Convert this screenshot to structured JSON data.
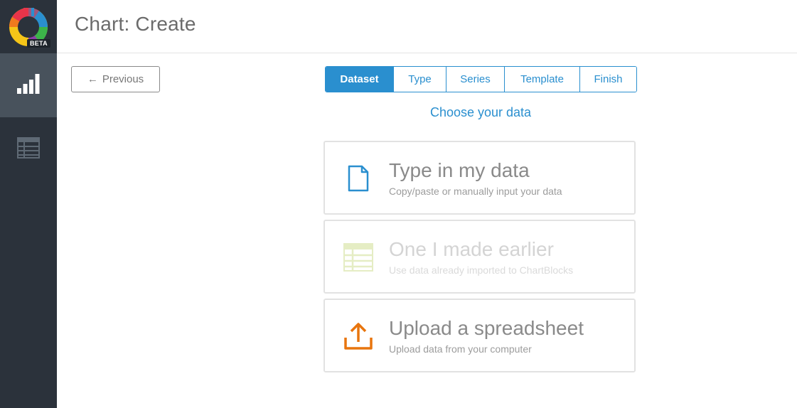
{
  "app": {
    "logo_badge": "BETA",
    "logo_icon": "chartblocks-logo-icon"
  },
  "sidebar": {
    "items": [
      {
        "name": "charts",
        "icon": "bar-chart-icon",
        "active": true
      },
      {
        "name": "data",
        "icon": "table-icon",
        "active": false
      }
    ]
  },
  "header": {
    "title": "Chart: Create"
  },
  "toolbar": {
    "previous_label": "Previous",
    "previous_icon": "arrow-left-icon"
  },
  "steps": [
    {
      "label": "Dataset",
      "active": true
    },
    {
      "label": "Type",
      "active": false
    },
    {
      "label": "Series",
      "active": false
    },
    {
      "label": "Template",
      "active": false
    },
    {
      "label": "Finish",
      "active": false
    }
  ],
  "main": {
    "heading": "Choose your data",
    "options": [
      {
        "title": "Type in my data",
        "subtitle": "Copy/paste or manually input your data",
        "icon": "document-icon",
        "enabled": true
      },
      {
        "title": "One I made earlier",
        "subtitle": "Use data already imported to ChartBlocks",
        "icon": "spreadsheet-icon",
        "enabled": false
      },
      {
        "title": "Upload a spreadsheet",
        "subtitle": "Upload data from your computer",
        "icon": "upload-icon",
        "enabled": true
      }
    ]
  },
  "colors": {
    "sidebar_bg": "#2b323b",
    "sidebar_active_bg": "#48525c",
    "accent_blue": "#2a8fcf",
    "upload_orange": "#e8750e",
    "disabled_green": "#e5edc4"
  }
}
